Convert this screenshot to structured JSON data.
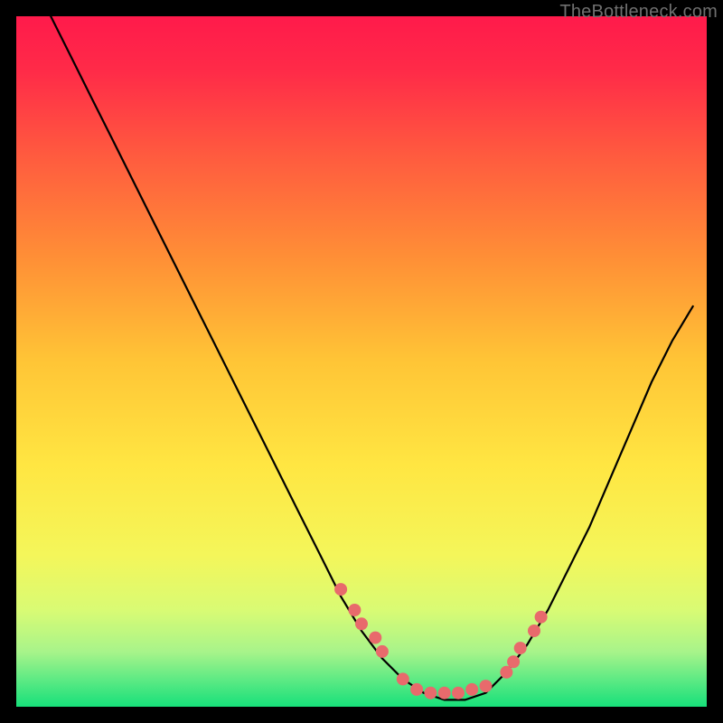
{
  "attribution": "TheBottleneck.com",
  "colors": {
    "gradient_top": "#ff1a4b",
    "gradient_mid": "#ffe642",
    "gradient_bottom": "#17e07a",
    "curve": "#000000",
    "marker": "#e86a6c",
    "background": "#000000"
  },
  "chart_data": {
    "type": "line",
    "title": "",
    "xlabel": "",
    "ylabel": "",
    "xlim": [
      0,
      100
    ],
    "ylim": [
      0,
      100
    ],
    "series": [
      {
        "name": "bottleneck-curve",
        "x": [
          5,
          8,
          11,
          14,
          17,
          20,
          23,
          26,
          29,
          32,
          35,
          38,
          41,
          44,
          47,
          50,
          53,
          56,
          59,
          62,
          65,
          68,
          71,
          74,
          77,
          80,
          83,
          86,
          89,
          92,
          95,
          98
        ],
        "y": [
          100,
          94,
          88,
          82,
          76,
          70,
          64,
          58,
          52,
          46,
          40,
          34,
          28,
          22,
          16,
          11,
          7,
          4,
          2,
          1,
          1,
          2,
          5,
          9,
          14,
          20,
          26,
          33,
          40,
          47,
          53,
          58
        ]
      }
    ],
    "markers": {
      "name": "highlight-points",
      "x": [
        47,
        49,
        50,
        52,
        53,
        56,
        58,
        60,
        62,
        64,
        66,
        68,
        71,
        72,
        73,
        75,
        76
      ],
      "y": [
        17,
        14,
        12,
        10,
        8,
        4,
        2.5,
        2,
        2,
        2,
        2.5,
        3,
        5,
        6.5,
        8.5,
        11,
        13
      ]
    }
  }
}
